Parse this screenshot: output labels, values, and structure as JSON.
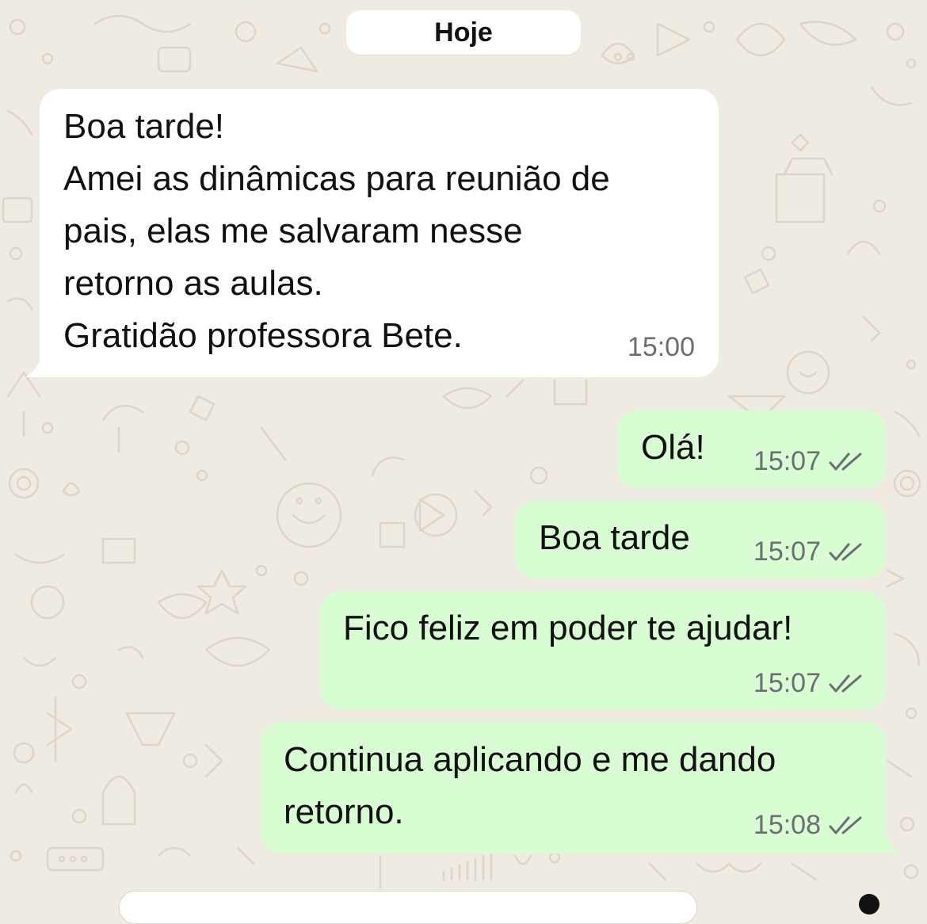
{
  "chat": {
    "date_label": "Hoje",
    "messages": [
      {
        "direction": "incoming",
        "lines": [
          "Boa tarde!",
          "Amei as dinâmicas para reunião de",
          "pais, elas me salvaram nesse",
          "retorno as aulas.",
          "Gratidão professora Bete."
        ],
        "time": "15:00"
      },
      {
        "direction": "outgoing",
        "lines": [
          "Olá!"
        ],
        "time": "15:07",
        "status_icon": "double-check-icon"
      },
      {
        "direction": "outgoing",
        "lines": [
          "Boa tarde"
        ],
        "time": "15:07",
        "status_icon": "double-check-icon"
      },
      {
        "direction": "outgoing",
        "lines": [
          "Fico feliz em poder te ajudar!"
        ],
        "time": "15:07",
        "status_icon": "double-check-icon"
      },
      {
        "direction": "outgoing",
        "lines": [
          "Continua aplicando e me dando",
          "retorno."
        ],
        "time": "15:08",
        "status_icon": "double-check-icon"
      }
    ]
  },
  "colors": {
    "background": "#efeae2",
    "incoming_bubble": "#ffffff",
    "outgoing_bubble": "#d9fdd3",
    "timestamp": "#6b6f72",
    "text": "#111111"
  }
}
